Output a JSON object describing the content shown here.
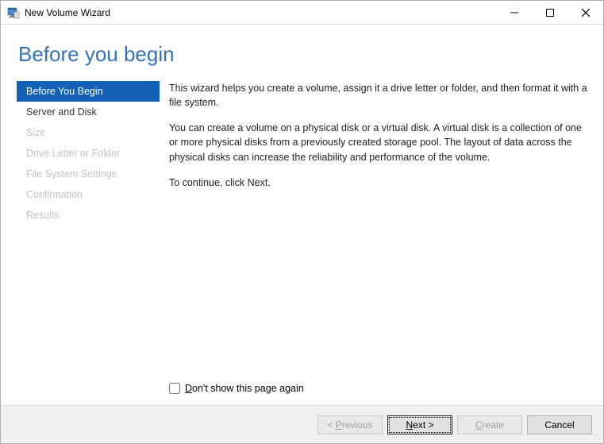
{
  "window": {
    "title": "New Volume Wizard"
  },
  "page": {
    "heading": "Before you begin"
  },
  "sidebar": {
    "steps": [
      {
        "label": "Before You Begin",
        "state": "active"
      },
      {
        "label": "Server and Disk",
        "state": "enabled"
      },
      {
        "label": "Size",
        "state": "disabled"
      },
      {
        "label": "Drive Letter or Folder",
        "state": "disabled"
      },
      {
        "label": "File System Settings",
        "state": "disabled"
      },
      {
        "label": "Confirmation",
        "state": "disabled"
      },
      {
        "label": "Results",
        "state": "disabled"
      }
    ]
  },
  "content": {
    "para1": "This wizard helps you create a volume, assign it a drive letter or folder, and then format it with a file system.",
    "para2": "You can create a volume on a physical disk or a virtual disk. A virtual disk is a collection of one or more physical disks from a previously created storage pool. The layout of data across the physical disks can increase the reliability and performance of the volume.",
    "para3": "To continue, click Next.",
    "dontshow_prefix": "D",
    "dontshow_rest": "on't show this page again",
    "dontshow_checked": false
  },
  "footer": {
    "prev_prefix": "< ",
    "prev_ul": "P",
    "prev_rest": "revious",
    "prev_enabled": false,
    "next_ul": "N",
    "next_rest": "ext >",
    "next_enabled": true,
    "next_default": true,
    "create_ul": "C",
    "create_rest": "reate",
    "create_enabled": false,
    "cancel_label": "Cancel",
    "cancel_enabled": true
  }
}
